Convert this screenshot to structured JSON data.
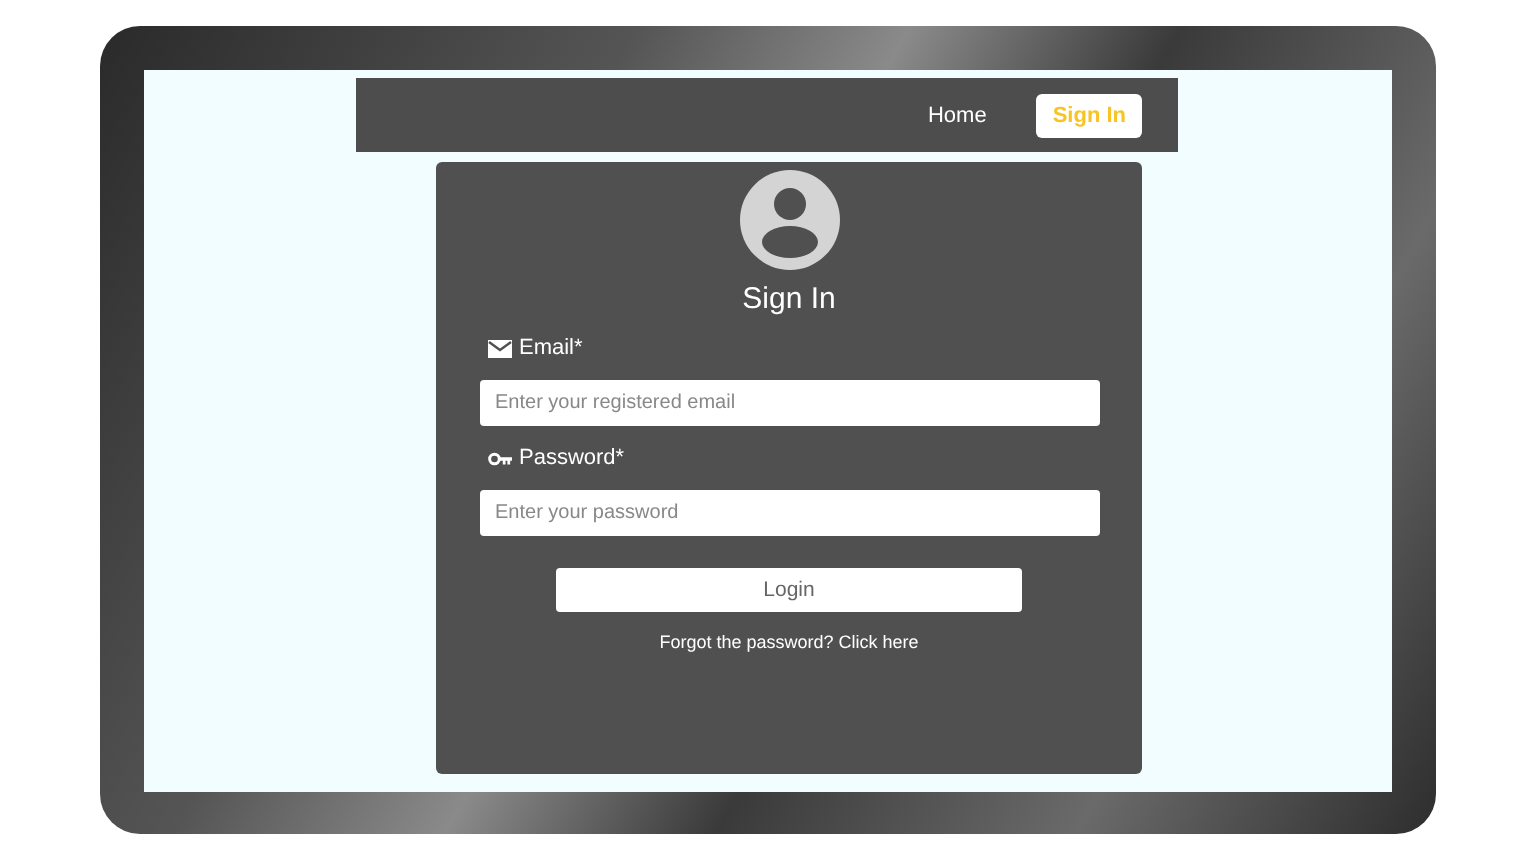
{
  "nav": {
    "items": [
      {
        "label": "Home",
        "selected": false
      },
      {
        "label": "Sign In",
        "selected": true
      }
    ]
  },
  "form": {
    "title": "Sign In",
    "fields": [
      {
        "kind": "email",
        "label": "Email*",
        "placeholder": "Enter your registered email"
      },
      {
        "kind": "password",
        "label": "Password*",
        "placeholder": "Enter your password"
      }
    ],
    "submit": "Login",
    "forgot": "Forgot the password? Click here"
  }
}
